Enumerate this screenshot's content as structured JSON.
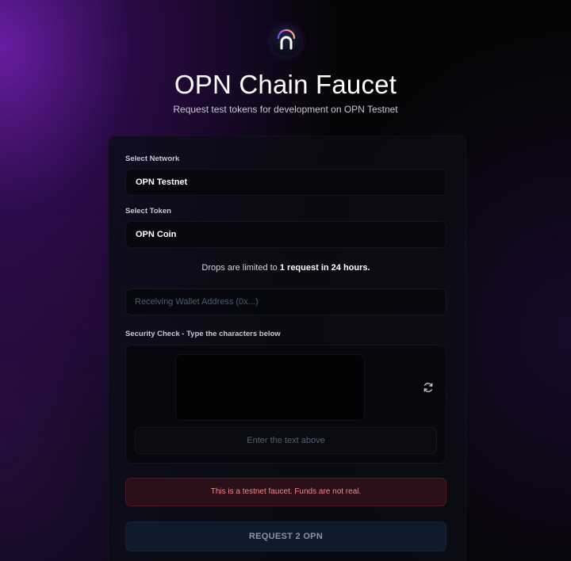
{
  "header": {
    "title": "OPN Chain Faucet",
    "subtitle": "Request test tokens for development on OPN Testnet",
    "logo_icon": "opn-logo-icon"
  },
  "form": {
    "network": {
      "label": "Select Network",
      "value": "OPN Testnet"
    },
    "token": {
      "label": "Select Token",
      "value": "OPN Coin"
    },
    "limit": {
      "prefix": "Drops are limited to ",
      "emphasis": "1 request in 24 hours."
    },
    "wallet": {
      "placeholder": "Receiving Wallet Address (0x...)",
      "value": ""
    },
    "captcha": {
      "label": "Security Check - Type the characters below",
      "placeholder": "Enter the text above",
      "value": "",
      "refresh_icon": "refresh-icon"
    },
    "notice": "This is a testnet faucet. Funds are not real.",
    "submit_label": "REQUEST 2 OPN"
  },
  "colors": {
    "background": "#050507",
    "accent_purple": "#6e1eaa",
    "alert_text": "#f08b8b",
    "alert_bg": "#2a0f18",
    "button_bg": "#0f1a2c"
  }
}
